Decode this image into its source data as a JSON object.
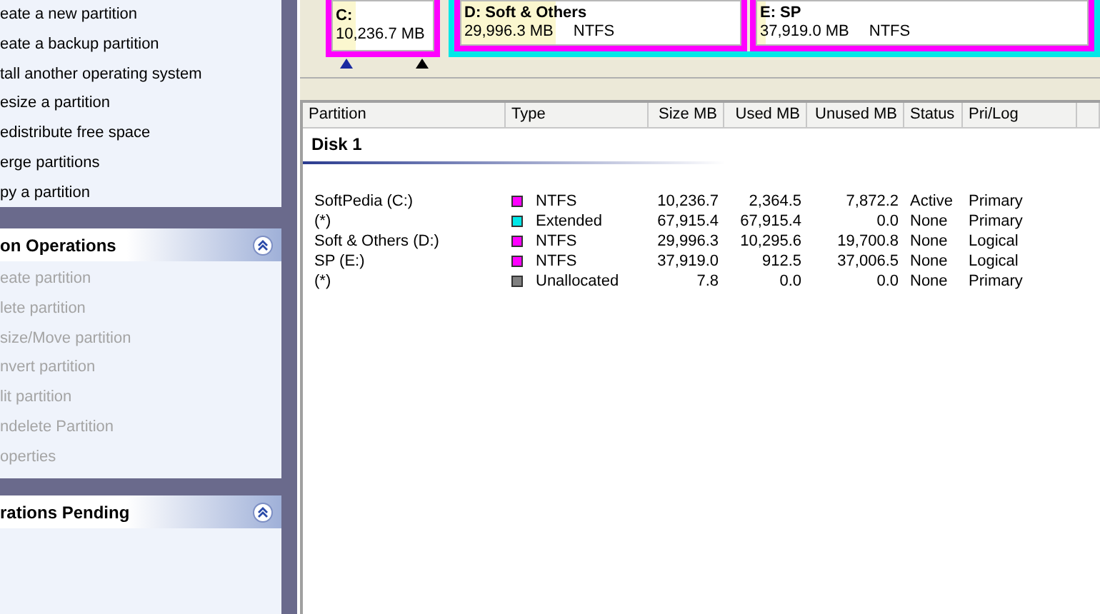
{
  "sidebar": {
    "sections": [
      {
        "items": [
          {
            "label": "eate a new partition",
            "disabled": false
          },
          {
            "label": "eate a backup partition",
            "disabled": false
          },
          {
            "label": "tall another operating system",
            "disabled": false
          },
          {
            "label": "esize a partition",
            "disabled": false
          },
          {
            "label": "edistribute free space",
            "disabled": false
          },
          {
            "label": "erge partitions",
            "disabled": false
          },
          {
            "label": "py a partition",
            "disabled": false
          }
        ]
      },
      {
        "title": "on Operations",
        "expanded": true,
        "items": [
          {
            "label": "eate partition",
            "disabled": true
          },
          {
            "label": "lete partition",
            "disabled": true
          },
          {
            "label": "size/Move partition",
            "disabled": true
          },
          {
            "label": "nvert partition",
            "disabled": true
          },
          {
            "label": "lit partition",
            "disabled": true
          },
          {
            "label": "ndelete Partition",
            "disabled": true
          },
          {
            "label": "operties",
            "disabled": true
          }
        ]
      },
      {
        "title": "rations Pending",
        "expanded": true
      }
    ]
  },
  "disk_map": {
    "partitions": [
      {
        "kind": "primary",
        "name": "C:",
        "size": "10,236.7 MB",
        "color": "#ff00ff",
        "level": 0.23
      },
      {
        "kind": "extended",
        "color": "#00e8e8",
        "children": [
          {
            "name": "D:  Soft & Others",
            "size": "29,996.3 MB",
            "fs": "NTFS",
            "color": "#ff00ff",
            "level": 0.34
          },
          {
            "name": "E:  SP",
            "size": "37,919.0 MB",
            "fs": "NTFS",
            "color": "#ff00ff",
            "level": 0.024
          }
        ]
      }
    ]
  },
  "table": {
    "columns": [
      "Partition",
      "Type",
      "Size MB",
      "Used MB",
      "Unused MB",
      "Status",
      "Pri/Log"
    ],
    "disk": "Disk 1",
    "rows": [
      {
        "partition": "SoftPedia (C:)",
        "color": "#ff00ff",
        "type": "NTFS",
        "size": "10,236.7",
        "used": "2,364.5",
        "unused": "7,872.2",
        "status": "Active",
        "prilog": "Primary"
      },
      {
        "partition": "(*)",
        "color": "#00e8e8",
        "type": "Extended",
        "size": "67,915.4",
        "used": "67,915.4",
        "unused": "0.0",
        "status": "None",
        "prilog": "Primary"
      },
      {
        "partition": "Soft & Others (D:)",
        "color": "#ff00ff",
        "type": "NTFS",
        "size": "29,996.3",
        "used": "10,295.6",
        "unused": "19,700.8",
        "status": "None",
        "prilog": "Logical"
      },
      {
        "partition": "SP (E:)",
        "color": "#ff00ff",
        "type": "NTFS",
        "size": "37,919.0",
        "used": "912.5",
        "unused": "37,006.5",
        "status": "None",
        "prilog": "Logical"
      },
      {
        "partition": "(*)",
        "color": "#808080",
        "type": "Unallocated",
        "size": "7.8",
        "used": "0.0",
        "unused": "0.0",
        "status": "None",
        "prilog": "Primary"
      }
    ]
  }
}
